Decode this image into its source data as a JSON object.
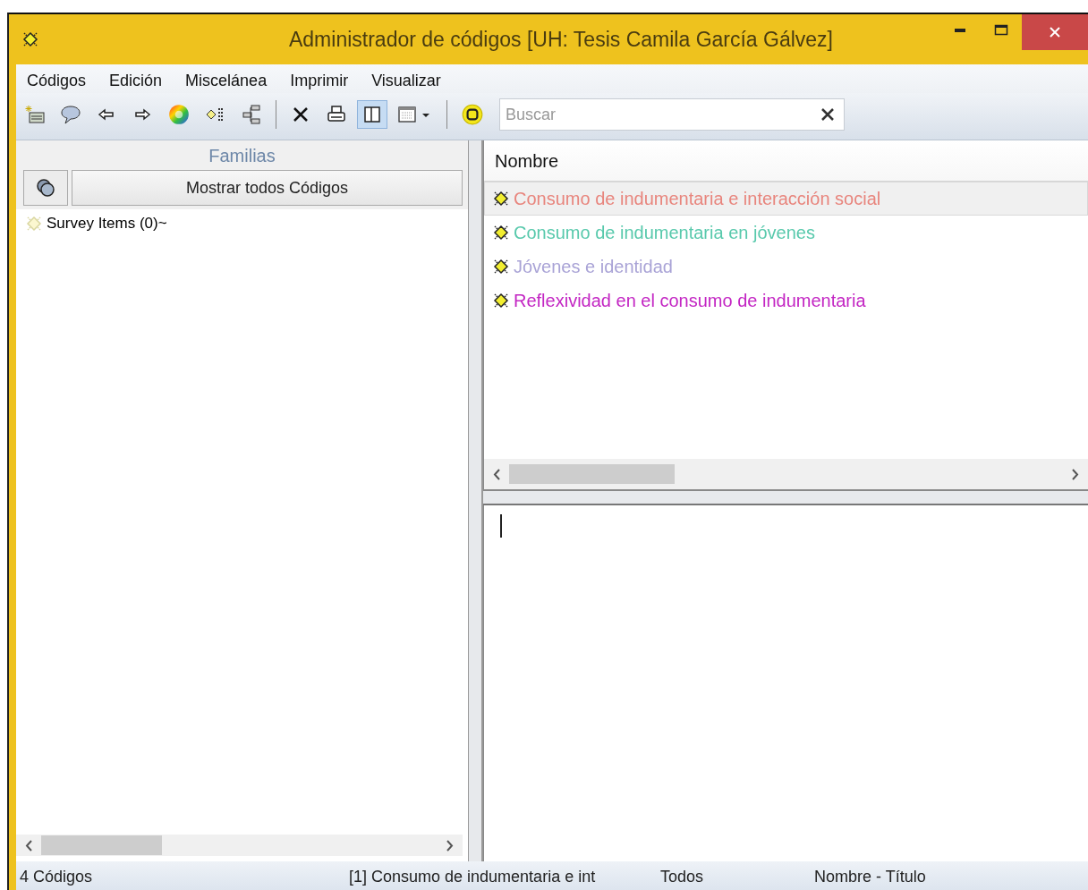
{
  "window": {
    "title": "Administrador de códigos [UH: Tesis Camila García Gálvez]"
  },
  "menu": [
    "Códigos",
    "Edición",
    "Miscelánea",
    "Imprimir",
    "Visualizar"
  ],
  "toolbar": [
    [
      {
        "kind": "new-code",
        "pressed": false
      },
      {
        "kind": "comment",
        "pressed": false
      },
      {
        "kind": "back",
        "pressed": false
      },
      {
        "kind": "forward",
        "pressed": false
      },
      {
        "kind": "color",
        "pressed": false
      },
      {
        "kind": "code-list",
        "pressed": false
      },
      {
        "kind": "network",
        "pressed": false
      }
    ],
    [
      {
        "kind": "delete",
        "pressed": false
      },
      {
        "kind": "print",
        "pressed": false
      },
      {
        "kind": "panel",
        "pressed": true
      },
      {
        "kind": "calendar",
        "pressed": false
      }
    ],
    [
      {
        "kind": "filter",
        "pressed": false
      }
    ]
  ],
  "search": {
    "placeholder": "Buscar"
  },
  "families": {
    "title": "Familias",
    "show_all_button": "Mostrar todos Códigos",
    "items": [
      {
        "label": "Survey Items (0)~"
      }
    ]
  },
  "codes": {
    "column": "Nombre",
    "rows": [
      {
        "name": "Consumo de indumentaria e interacción social",
        "color": "#e8857d",
        "selected": true
      },
      {
        "name": "Consumo de indumentaria en jóvenes",
        "color": "#58c9ac",
        "selected": false
      },
      {
        "name": "Jóvenes e identidad",
        "color": "#a9a3d6",
        "selected": false
      },
      {
        "name": "Reflexividad en el consumo de indumentaria",
        "color": "#c326c3",
        "selected": false
      }
    ]
  },
  "status_bar": [
    "4 Códigos",
    "[1] Consumo de indumentaria e int",
    "Todos",
    "Nombre - Título"
  ]
}
